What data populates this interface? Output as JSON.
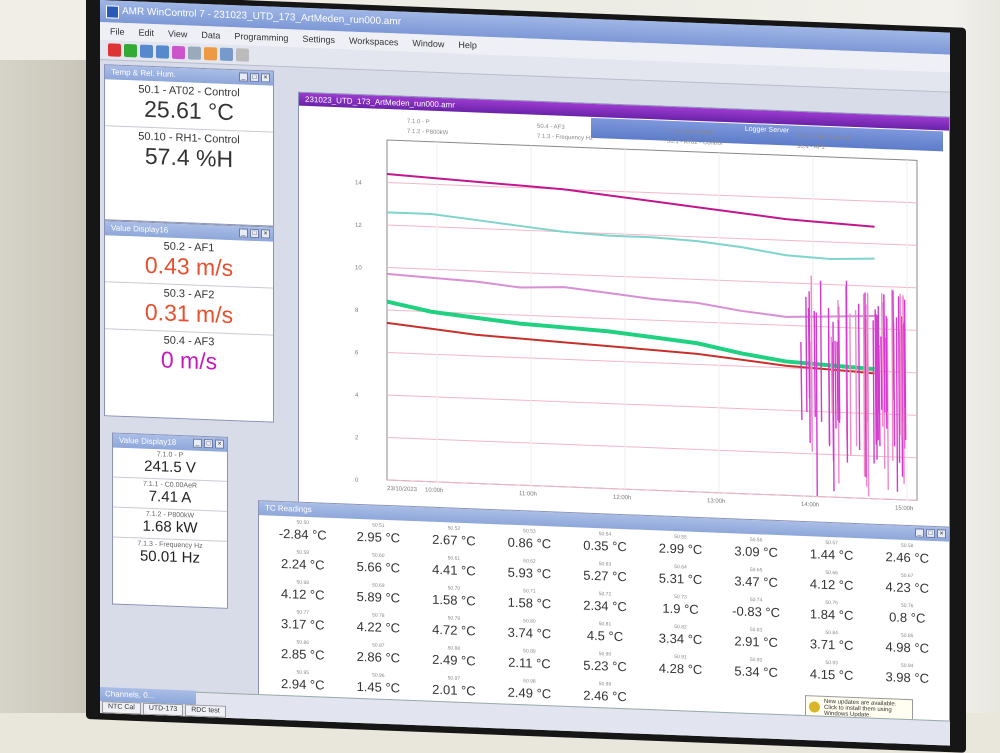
{
  "window": {
    "title": "AMR WinControl 7 - 231023_UTD_173_ArtMeden_run000.amr"
  },
  "menu": [
    "File",
    "Edit",
    "View",
    "Data",
    "Programming",
    "Settings",
    "Workspaces",
    "Window",
    "Help"
  ],
  "temp_panel": {
    "title": "Temp & Rel. Hum.",
    "items": [
      {
        "label": "50.1 - AT02 - Control",
        "value": "25.61 °C"
      },
      {
        "label": "50.10 - RH1- Control",
        "value": "57.4 %H"
      }
    ]
  },
  "value_display16": {
    "title": "Value Display16",
    "items": [
      {
        "label": "50.2 - AF1",
        "value": "0.43 m/s"
      },
      {
        "label": "50.3 - AF2",
        "value": "0.31 m/s"
      },
      {
        "label": "50.4 - AF3",
        "value": "0 m/s"
      }
    ]
  },
  "value_display18": {
    "title": "Value Display18",
    "items": [
      {
        "label": "7.1.0 - P",
        "value": "241.5 V"
      },
      {
        "label": "7.1.1 - C0.00AeR",
        "value": "7.41 A"
      },
      {
        "label": "7.1.2 - P800kW",
        "value": "1.68 kW"
      },
      {
        "label": "7.1.3 - Frequency Hz",
        "value": "50.01 Hz"
      }
    ]
  },
  "chart_window": {
    "title": "231023_UTD_173_ArtMeden_run000.amr",
    "popup_title": "Logger Server"
  },
  "chart_data": {
    "type": "line",
    "legend": [
      "7.1.0 - P",
      "50.4 - AF3",
      "7.1.1 - C0.00AeR",
      "50.10 - Rel. Control",
      "7.1.2 - P800kW",
      "7.1.3 - Frequency Hz",
      "50.1 - AT02 - Control",
      "50.4 - AF1"
    ],
    "x_ticks": [
      "10:00h",
      "11:00h",
      "12:00h",
      "13:00h",
      "14:00h",
      "15:00h"
    ],
    "start_label": "23/10/2023",
    "y_ticks": [
      "0",
      "2",
      "4",
      "6",
      "8",
      "10",
      "12",
      "14"
    ],
    "series": [
      {
        "color": "#c2168f",
        "values": [
          14.4,
          14.3,
          14.2,
          14.1,
          14.0,
          13.8,
          13.6,
          13.4,
          13.2,
          13.0,
          12.9,
          12.8
        ]
      },
      {
        "color": "#7fd4cc",
        "values": [
          12.6,
          12.6,
          12.4,
          12.2,
          12.0,
          11.9,
          11.9,
          11.8,
          11.6,
          11.3,
          11.2,
          11.3
        ]
      },
      {
        "color": "#d88fd4",
        "values": [
          9.7,
          9.6,
          9.5,
          9.3,
          9.4,
          9.2,
          9.0,
          8.9,
          8.6,
          8.4,
          8.5,
          8.6
        ]
      },
      {
        "color": "#1fd180",
        "values": [
          8.4,
          8.0,
          7.8,
          7.6,
          7.5,
          7.4,
          7.2,
          7.0,
          6.6,
          6.3,
          6.2,
          6.1
        ]
      },
      {
        "color": "#c8302b",
        "values": [
          7.4,
          7.2,
          7.0,
          6.9,
          6.8,
          6.7,
          6.6,
          6.5,
          6.3,
          6.1,
          6.0,
          5.9
        ]
      }
    ]
  },
  "temps": {
    "title": "TC Readings",
    "cells": [
      {
        "l": "50.50",
        "v": "-2.84 °C"
      },
      {
        "l": "50.51",
        "v": "2.95 °C"
      },
      {
        "l": "50.52",
        "v": "2.67 °C"
      },
      {
        "l": "50.53",
        "v": "0.86 °C"
      },
      {
        "l": "50.54",
        "v": "0.35 °C"
      },
      {
        "l": "50.55",
        "v": "2.99 °C"
      },
      {
        "l": "50.56",
        "v": "3.09 °C"
      },
      {
        "l": "50.57",
        "v": "1.44 °C"
      },
      {
        "l": "50.58",
        "v": "2.46 °C"
      },
      {
        "l": "50.59",
        "v": "2.24 °C"
      },
      {
        "l": "50.60",
        "v": "5.66 °C"
      },
      {
        "l": "50.61",
        "v": "4.41 °C"
      },
      {
        "l": "50.62",
        "v": "5.93 °C"
      },
      {
        "l": "50.63",
        "v": "5.27 °C"
      },
      {
        "l": "50.64",
        "v": "5.31 °C"
      },
      {
        "l": "50.65",
        "v": "3.47 °C"
      },
      {
        "l": "50.66",
        "v": "4.12 °C"
      },
      {
        "l": "50.67",
        "v": "4.23 °C"
      },
      {
        "l": "50.68",
        "v": "4.12 °C"
      },
      {
        "l": "50.69",
        "v": "5.89 °C"
      },
      {
        "l": "50.70",
        "v": "1.58 °C"
      },
      {
        "l": "50.71",
        "v": "1.58 °C"
      },
      {
        "l": "50.72",
        "v": "2.34 °C"
      },
      {
        "l": "50.73",
        "v": "1.9 °C"
      },
      {
        "l": "50.74",
        "v": "-0.83 °C"
      },
      {
        "l": "50.75",
        "v": "1.84 °C"
      },
      {
        "l": "50.76",
        "v": "0.8 °C"
      },
      {
        "l": "50.77",
        "v": "3.17 °C"
      },
      {
        "l": "50.78",
        "v": "4.22 °C"
      },
      {
        "l": "50.79",
        "v": "4.72 °C"
      },
      {
        "l": "50.80",
        "v": "3.74 °C"
      },
      {
        "l": "50.81",
        "v": "4.5 °C"
      },
      {
        "l": "50.82",
        "v": "3.34 °C"
      },
      {
        "l": "50.83",
        "v": "2.91 °C"
      },
      {
        "l": "50.84",
        "v": "3.71 °C"
      },
      {
        "l": "50.85",
        "v": "4.98 °C"
      },
      {
        "l": "50.86",
        "v": "2.85 °C"
      },
      {
        "l": "50.87",
        "v": "2.86 °C"
      },
      {
        "l": "50.88",
        "v": "2.49 °C"
      },
      {
        "l": "50.89",
        "v": "2.11 °C"
      },
      {
        "l": "50.90",
        "v": "5.23 °C"
      },
      {
        "l": "50.91",
        "v": "4.28 °C"
      },
      {
        "l": "50.92",
        "v": "5.34 °C"
      },
      {
        "l": "50.93",
        "v": "4.15 °C"
      },
      {
        "l": "50.94",
        "v": "3.98 °C"
      },
      {
        "l": "50.95",
        "v": "2.94 °C"
      },
      {
        "l": "50.96",
        "v": "1.45 °C"
      },
      {
        "l": "50.97",
        "v": "2.01 °C"
      },
      {
        "l": "50.98",
        "v": "2.49 °C"
      },
      {
        "l": "50.99",
        "v": "2.46 °C"
      }
    ]
  },
  "bottom": {
    "channels_title": "Channels, 0...",
    "tabs": [
      "NTC Cal",
      "UTD-173",
      "RDC test"
    ],
    "notification": "New updates are available. Click to install them using Windows Update."
  }
}
